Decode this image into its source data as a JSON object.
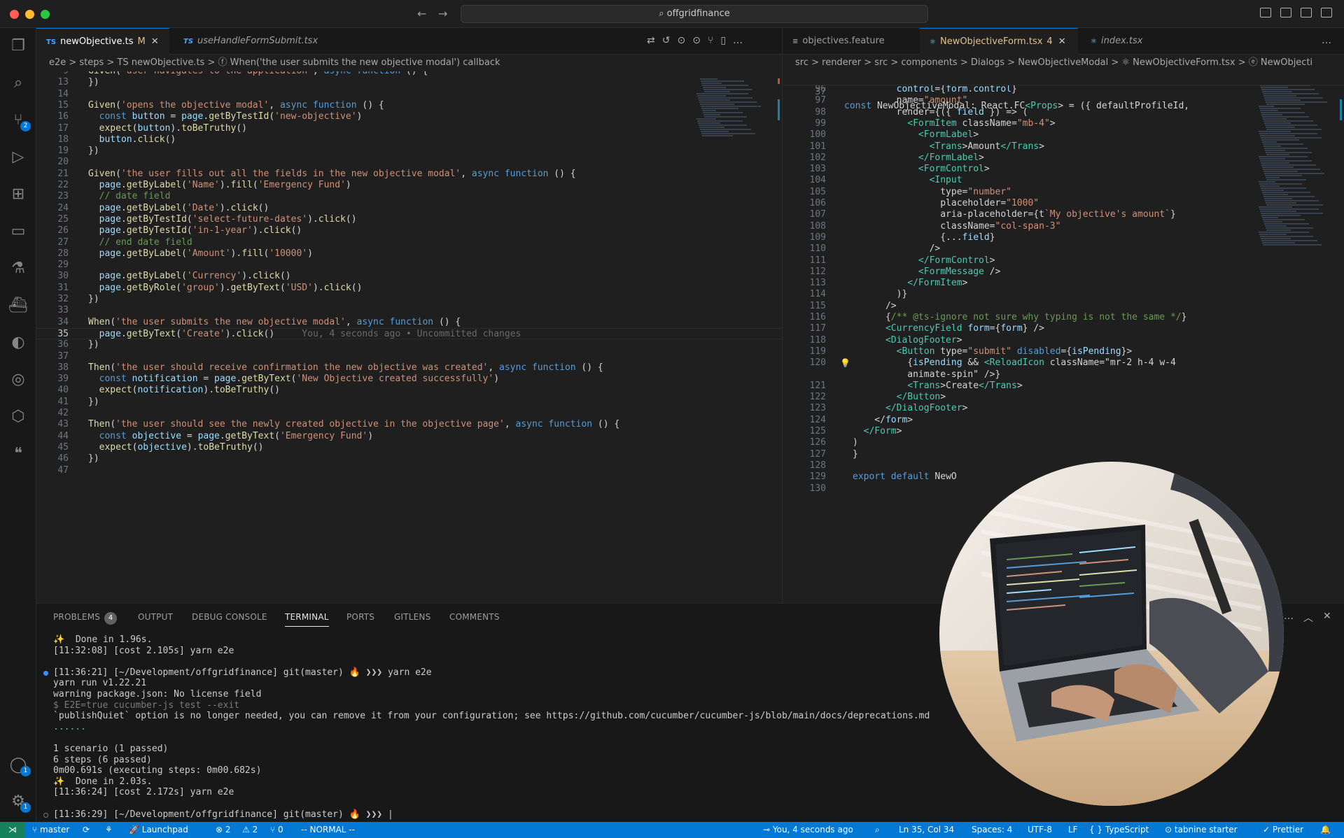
{
  "window": {
    "title": "offgridfinance",
    "search_icon": "search-icon"
  },
  "activity_bar": {
    "items": [
      {
        "name": "explorer-icon",
        "glyph": "❐"
      },
      {
        "name": "search-icon",
        "glyph": "⌕"
      },
      {
        "name": "source-control-icon",
        "glyph": "⑂",
        "badge": "2"
      },
      {
        "name": "run-debug-icon",
        "glyph": "▷"
      },
      {
        "name": "extensions-icon",
        "glyph": "⊞"
      },
      {
        "name": "remote-explorer-icon",
        "glyph": "▭"
      },
      {
        "name": "testing-icon",
        "glyph": "⚗"
      },
      {
        "name": "docker-icon",
        "glyph": "⛴"
      },
      {
        "name": "gitlens-icon",
        "glyph": "◐"
      },
      {
        "name": "gitlens-inspect-icon",
        "glyph": "◎"
      },
      {
        "name": "cube-icon",
        "glyph": "⬡"
      },
      {
        "name": "quote-icon",
        "glyph": "❝"
      }
    ],
    "bottom": [
      {
        "name": "account-icon",
        "glyph": "◯",
        "badge": "1"
      },
      {
        "name": "manage-gear-icon",
        "glyph": "⚙",
        "badge": "1"
      }
    ]
  },
  "left_editor": {
    "tabs": [
      {
        "prefix": "TS",
        "label": "newObjective.ts",
        "modified": "M",
        "active": true
      },
      {
        "prefix": "TS",
        "label": "useHandleFormSubmit.tsx",
        "modified": "",
        "active": false
      }
    ],
    "breadcrumb": "e2e  >  steps  >  TS newObjective.ts  >  ⓕ When('the user submits the new objective modal') callback",
    "lines": [
      {
        "n": "9",
        "t": "Given('user navigates to the application', async function () {"
      },
      {
        "n": "13",
        "t": "})"
      },
      {
        "n": "14",
        "t": ""
      },
      {
        "n": "15",
        "t": "Given('opens the objective modal', async function () {"
      },
      {
        "n": "16",
        "t": "  const button = page.getByTestId('new-objective')"
      },
      {
        "n": "17",
        "t": "  expect(button).toBeTruthy()"
      },
      {
        "n": "18",
        "t": "  button.click()"
      },
      {
        "n": "19",
        "t": "})"
      },
      {
        "n": "20",
        "t": ""
      },
      {
        "n": "21",
        "t": "Given('the user fills out all the fields in the new objective modal', async function () {"
      },
      {
        "n": "22",
        "t": "  page.getByLabel('Name').fill('Emergency Fund')"
      },
      {
        "n": "23",
        "t": "  // date field"
      },
      {
        "n": "24",
        "t": "  page.getByLabel('Date').click()"
      },
      {
        "n": "25",
        "t": "  page.getByTestId('select-future-dates').click()"
      },
      {
        "n": "26",
        "t": "  page.getByTestId('in-1-year').click()"
      },
      {
        "n": "27",
        "t": "  // end date field"
      },
      {
        "n": "28",
        "t": "  page.getByLabel('Amount').fill('10000')"
      },
      {
        "n": "29",
        "t": ""
      },
      {
        "n": "30",
        "t": "  page.getByLabel('Currency').click()"
      },
      {
        "n": "31",
        "t": "  page.getByRole('group').getByText('USD').click()"
      },
      {
        "n": "32",
        "t": "})"
      },
      {
        "n": "33",
        "t": ""
      },
      {
        "n": "34",
        "t": "When('the user submits the new objective modal', async function () {"
      },
      {
        "n": "35",
        "t": "  page.getByText('Create').click()",
        "ghost": "     You, 4 seconds ago • Uncommitted changes"
      },
      {
        "n": "36",
        "t": "})"
      },
      {
        "n": "37",
        "t": ""
      },
      {
        "n": "38",
        "t": "Then('the user should receive confirmation the new objective was created', async function () {"
      },
      {
        "n": "39",
        "t": "  const notification = page.getByText('New Objective created successfully')"
      },
      {
        "n": "40",
        "t": "  expect(notification).toBeTruthy()"
      },
      {
        "n": "41",
        "t": "})"
      },
      {
        "n": "42",
        "t": ""
      },
      {
        "n": "43",
        "t": "Then('the user should see the newly created objective in the objective page', async function () {"
      },
      {
        "n": "44",
        "t": "  const objective = page.getByText('Emergency Fund')"
      },
      {
        "n": "45",
        "t": "  expect(objective).toBeTruthy()"
      },
      {
        "n": "46",
        "t": "})"
      },
      {
        "n": "47",
        "t": ""
      }
    ]
  },
  "right_editor": {
    "tabs": [
      {
        "prefix": "≡",
        "label": "objectives.feature",
        "modified": "",
        "active": false
      },
      {
        "prefix": "⚛",
        "label": "NewObjectiveForm.tsx",
        "modified": "4",
        "active": true
      },
      {
        "prefix": "⚛",
        "label": "index.tsx",
        "modified": "",
        "active": false
      }
    ],
    "breadcrumb": "src  >  renderer  >  src  >  components  >  Dialogs  >  NewObjectiveModal  >  ⚛ NewObjectiveForm.tsx  >  ⓔ NewObjecti",
    "sticky": {
      "n": "37",
      "t": "const NewObjectiveModal: React.FC<Props> = ({ defaultProfileId,"
    },
    "lines": [
      {
        "n": "96",
        "t": "        control={form.control}"
      },
      {
        "n": "97",
        "t": "        name=\"amount\""
      },
      {
        "n": "98",
        "t": "        render={({ field }) => ("
      },
      {
        "n": "99",
        "t": "          <FormItem className=\"mb-4\">"
      },
      {
        "n": "100",
        "t": "            <FormLabel>"
      },
      {
        "n": "101",
        "t": "              <Trans>Amount</Trans>"
      },
      {
        "n": "102",
        "t": "            </FormLabel>"
      },
      {
        "n": "103",
        "t": "            <FormControl>"
      },
      {
        "n": "104",
        "t": "              <Input"
      },
      {
        "n": "105",
        "t": "                type=\"number\""
      },
      {
        "n": "106",
        "t": "                placeholder=\"1000\""
      },
      {
        "n": "107",
        "t": "                aria-placeholder={t`My objective's amount`}"
      },
      {
        "n": "108",
        "t": "                className=\"col-span-3\""
      },
      {
        "n": "109",
        "t": "                {...field}"
      },
      {
        "n": "110",
        "t": "              />"
      },
      {
        "n": "111",
        "t": "            </FormControl>"
      },
      {
        "n": "112",
        "t": "            <FormMessage />"
      },
      {
        "n": "113",
        "t": "          </FormItem>"
      },
      {
        "n": "114",
        "t": "        )}"
      },
      {
        "n": "115",
        "t": "      />"
      },
      {
        "n": "116",
        "t": "      {/** @ts-ignore not sure why typing is not the same */}"
      },
      {
        "n": "117",
        "t": "      <CurrencyField form={form} />"
      },
      {
        "n": "118",
        "t": "      <DialogFooter>"
      },
      {
        "n": "119",
        "t": "        <Button type=\"submit\" disabled={isPending}>"
      },
      {
        "n": "120",
        "t": "          {isPending && <ReloadIcon className=\"mr-2 h-4 w-4"
      },
      {
        "n": "",
        "t": "          animate-spin\" />}"
      },
      {
        "n": "121",
        "t": "          <Trans>Create</Trans>"
      },
      {
        "n": "122",
        "t": "        </Button>"
      },
      {
        "n": "123",
        "t": "      </DialogFooter>"
      },
      {
        "n": "124",
        "t": "    </form>"
      },
      {
        "n": "125",
        "t": "  </Form>"
      },
      {
        "n": "126",
        "t": ")"
      },
      {
        "n": "127",
        "t": "}"
      },
      {
        "n": "128",
        "t": ""
      },
      {
        "n": "129",
        "t": "export default NewO"
      },
      {
        "n": "130",
        "t": ""
      }
    ]
  },
  "panel": {
    "tabs": [
      {
        "label": "PROBLEMS",
        "badge": "4"
      },
      {
        "label": "OUTPUT"
      },
      {
        "label": "DEBUG CONSOLE"
      },
      {
        "label": "TERMINAL",
        "active": true
      },
      {
        "label": "PORTS"
      },
      {
        "label": "GITLENS"
      },
      {
        "label": "COMMENTS"
      }
    ],
    "terminal_lines": [
      {
        "t": "✨  Done in 1.96s."
      },
      {
        "t": "[11:32:08] [cost 2.105s] yarn e2e"
      },
      {
        "t": ""
      },
      {
        "t": "[11:36:21] [~/Development/offgridfinance] git(master) 🔥 ❯❯❯ yarn e2e",
        "dot": "filled"
      },
      {
        "t": "yarn run v1.22.21"
      },
      {
        "t": "warning package.json: No license field"
      },
      {
        "t": "$ E2E=true cucumber-js test --exit"
      },
      {
        "t": "`publishQuiet` option is no longer needed, you can remove it from your configuration; see https://github.com/cucumber/cucumber-js/blob/main/docs/deprecations.md"
      },
      {
        "t": "......"
      },
      {
        "t": ""
      },
      {
        "t": "1 scenario (1 passed)"
      },
      {
        "t": "6 steps (6 passed)"
      },
      {
        "t": "0m00.691s (executing steps: 0m00.682s)"
      },
      {
        "t": "✨  Done in 2.03s."
      },
      {
        "t": "[11:36:24] [cost 2.172s] yarn e2e"
      },
      {
        "t": ""
      },
      {
        "t": "[11:36:29] [~/Development/offgridfinance] git(master) 🔥 ❯❯❯ |",
        "dot": "hollow"
      }
    ]
  },
  "status_bar": {
    "branch": "master",
    "sync": "⟳",
    "launchpad": "Launchpad",
    "errors": "⊗ 2",
    "warnings": "⚠ 2",
    "ports": "⑂ 0",
    "vim_mode": "-- NORMAL --",
    "blame": "You, 4 seconds ago",
    "position": "Ln 35, Col 34",
    "spaces": "Spaces: 4",
    "encoding": "UTF-8",
    "eol": "LF",
    "language": "{ }  TypeScript",
    "tabnine": "⊙ tabnine starter",
    "prettier": "✓ Prettier",
    "bell": "🔔"
  },
  "colors": {
    "accent": "#0078d4",
    "keyword": "#569cd6",
    "string": "#ce9178",
    "function": "#dcdcaa",
    "variable": "#9cdcfe",
    "comment": "#6a9955",
    "tag": "#4ec9b0"
  }
}
